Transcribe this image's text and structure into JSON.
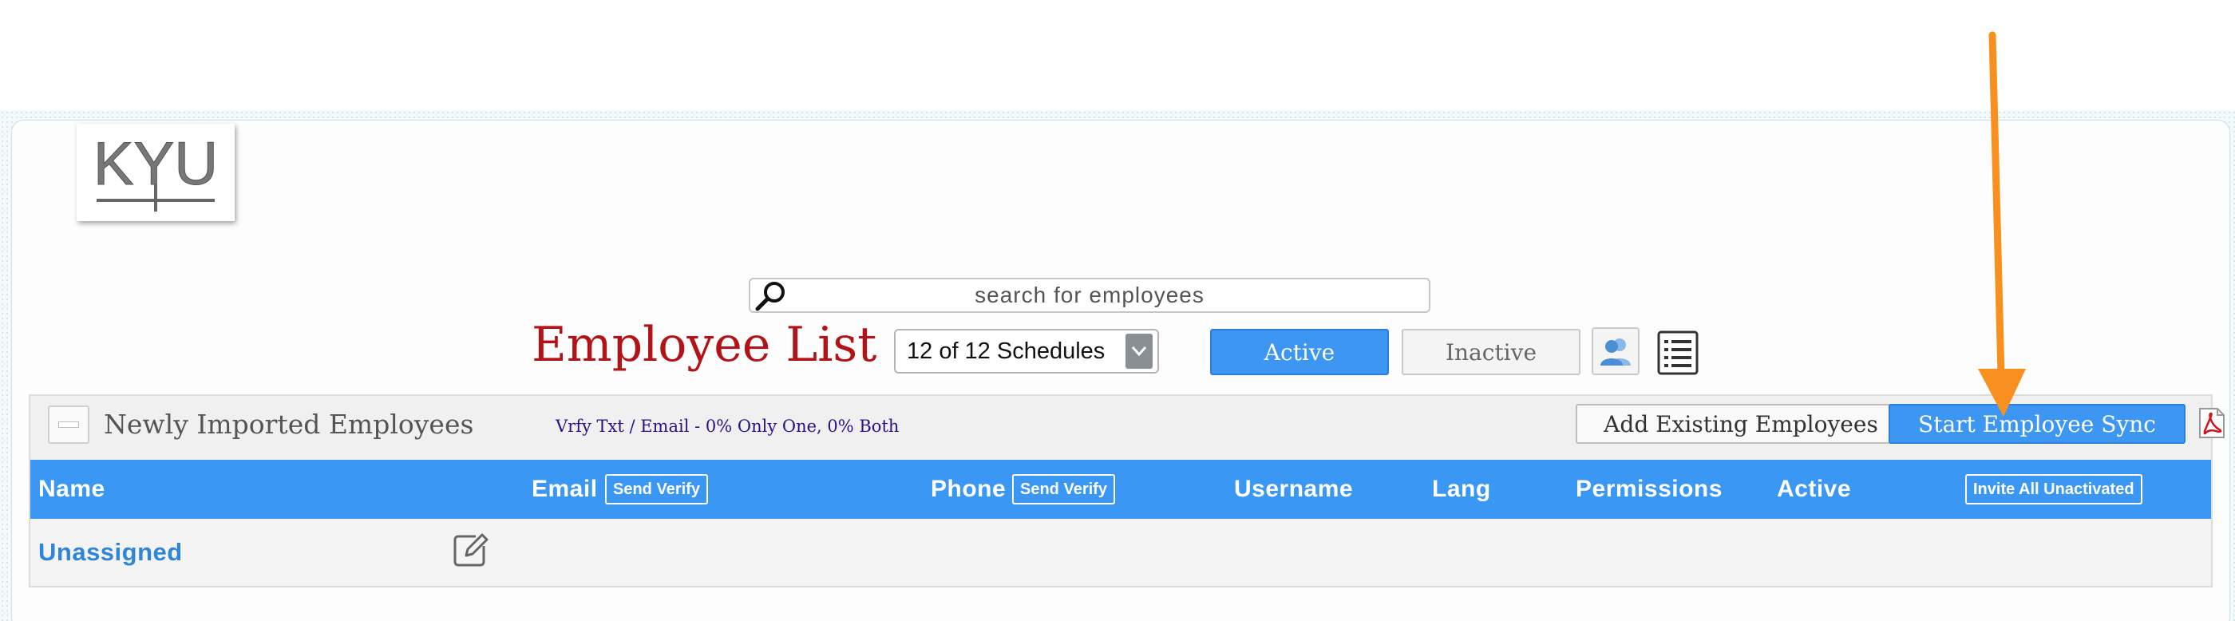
{
  "logo": {
    "text": "KYU"
  },
  "search": {
    "placeholder": "search for employees"
  },
  "header": {
    "title": "Employee List",
    "schedules_selected": "12 of 12 Schedules",
    "active_label": "Active",
    "inactive_label": "Inactive"
  },
  "section": {
    "title": "Newly Imported Employees",
    "verify_stats": "Vrfy Txt / Email - 0% Only One, 0% Both",
    "add_existing_label": "Add Existing Employees",
    "sync_label": "Start Employee Sync"
  },
  "table": {
    "columns": {
      "name": "Name",
      "email": "Email",
      "phone": "Phone",
      "username": "Username",
      "lang": "Lang",
      "permissions": "Permissions",
      "active": "Active"
    },
    "email_send_verify": "Send Verify",
    "phone_send_verify": "Send Verify",
    "invite_all": "Invite All Unactivated",
    "rows": [
      {
        "name": "Unassigned"
      }
    ]
  },
  "colors": {
    "accent": "#3a97f3",
    "title_red": "#b31217",
    "annotation_arrow": "#f7901e",
    "stats_text": "#2b0f86"
  },
  "icons": [
    "search-icon",
    "chevron-down-icon",
    "people-icon",
    "list-icon",
    "pdf-icon",
    "edit-icon",
    "collapse-icon"
  ]
}
